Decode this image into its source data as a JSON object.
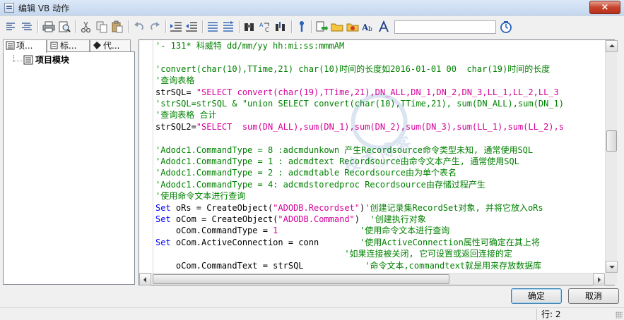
{
  "window": {
    "title": "编辑 VB 动作",
    "close_label": "×",
    "icon": "vb-editor-icon"
  },
  "toolbar": {
    "buttons": [
      "align-left-icon",
      "align-center-icon",
      "print-icon",
      "print-preview-icon",
      "cut-icon",
      "copy-icon",
      "paste-icon",
      "undo-icon",
      "redo-icon",
      "indent-icon",
      "outdent-icon",
      "comment-icon",
      "uncomment-icon",
      "find-icon",
      "replace-icon",
      "goto-icon",
      "help-icon",
      "insert-icon",
      "open-folder-icon",
      "new-folder-icon",
      "font-icon",
      "syntax-icon",
      "clock-icon"
    ],
    "search_value": ""
  },
  "tabs": [
    {
      "label": "项...",
      "icon": "module-icon"
    },
    {
      "label": "标...",
      "icon": "tag-icon"
    },
    {
      "label": "代...",
      "icon": "code-icon"
    }
  ],
  "tree": {
    "items": [
      {
        "label": "项目模块",
        "icon": "module-icon"
      }
    ]
  },
  "colors": {
    "comment": "#008000",
    "keyword": "#0000ff",
    "string": "#d4009a",
    "text": "#000000"
  },
  "code_lines": [
    [
      {
        "t": "'- 131* 科威特 dd/mm/yy hh:mi:ss:mmmAM",
        "c": "comment"
      }
    ],
    [
      {
        "t": "",
        "c": "text"
      }
    ],
    [
      {
        "t": "'convert(char(10),TTime,21) char(10)时间的长度如2016-01-01 00  char(19)时间的长度",
        "c": "comment"
      }
    ],
    [
      {
        "t": "'查询表格",
        "c": "comment"
      }
    ],
    [
      {
        "t": "strSQL= ",
        "c": "text"
      },
      {
        "t": "\"SELECT convert(char(19),TTime,21),DN_ALL,DN_1,DN_2,DN_3,LL_1,LL_2,LL_3",
        "c": "string"
      }
    ],
    [
      {
        "t": "'strSQL=strSQL & \"union SELECT convert(char(10),TTime,21), sum(DN_ALL),sum(DN_1)",
        "c": "comment"
      }
    ],
    [
      {
        "t": "'查询表格 合计",
        "c": "comment"
      }
    ],
    [
      {
        "t": "strSQL2=",
        "c": "text"
      },
      {
        "t": "\"SELECT  sum(DN_ALL),sum(DN_1),sum(DN_2),sum(DN_3),sum(LL_1),sum(LL_2),s",
        "c": "string"
      }
    ],
    [
      {
        "t": "",
        "c": "text"
      }
    ],
    [
      {
        "t": "'Adodc1.CommandType = 8 :adcmdunkown 产生Recordsource命令类型未知, 通常使用SQL",
        "c": "comment"
      }
    ],
    [
      {
        "t": "'Adodc1.CommandType = 1 : adcmdtext Recordsource由命令文本产生, 通常使用SQL",
        "c": "comment"
      }
    ],
    [
      {
        "t": "'Adodc1.CommandType = 2 : adcmdtable Recordsource由为单个表名",
        "c": "comment"
      }
    ],
    [
      {
        "t": "'Adodc1.CommandType = 4: adcmdstoredproc Recordsource由存储过程产生",
        "c": "comment"
      }
    ],
    [
      {
        "t": "'使用命令文本进行查询",
        "c": "comment"
      }
    ],
    [
      {
        "t": "Set",
        "c": "keyword"
      },
      {
        "t": " oRs = CreateObject(",
        "c": "text"
      },
      {
        "t": "\"ADODB.Recordset\"",
        "c": "string"
      },
      {
        "t": ")",
        "c": "text"
      },
      {
        "t": "'创建记录集RecordSet对象, 并将它放入oRs",
        "c": "comment"
      }
    ],
    [
      {
        "t": "Set",
        "c": "keyword"
      },
      {
        "t": " oCom = CreateObject(",
        "c": "text"
      },
      {
        "t": "\"ADODB.Command\"",
        "c": "string"
      },
      {
        "t": ")  ",
        "c": "text"
      },
      {
        "t": "'创建执行对象",
        "c": "comment"
      }
    ],
    [
      {
        "t": "    oCom.CommandType = ",
        "c": "text"
      },
      {
        "t": "1",
        "c": "string"
      },
      {
        "t": "                ",
        "c": "text"
      },
      {
        "t": "'使用命令文本进行查询",
        "c": "comment"
      }
    ],
    [
      {
        "t": "Set",
        "c": "keyword"
      },
      {
        "t": " oCom.ActiveConnection = conn        ",
        "c": "text"
      },
      {
        "t": "'使用ActiveConnection属性可确定在其上将",
        "c": "comment"
      }
    ],
    [
      {
        "t": "                                     ",
        "c": "text"
      },
      {
        "t": "'如果连接被关闭, 它可设置或返回连接的定",
        "c": "comment"
      }
    ],
    [
      {
        "t": "    oCom.CommandText = strSQL            ",
        "c": "text"
      },
      {
        "t": "'命令文本,commandtext就是用来存放数据库",
        "c": "comment"
      }
    ]
  ],
  "buttons": {
    "ok": "确定",
    "cancel": "取消"
  },
  "status": {
    "line": "行: 2"
  },
  "watermark": {
    "text": "技术博客",
    "sub": "blog.csdn.net"
  }
}
